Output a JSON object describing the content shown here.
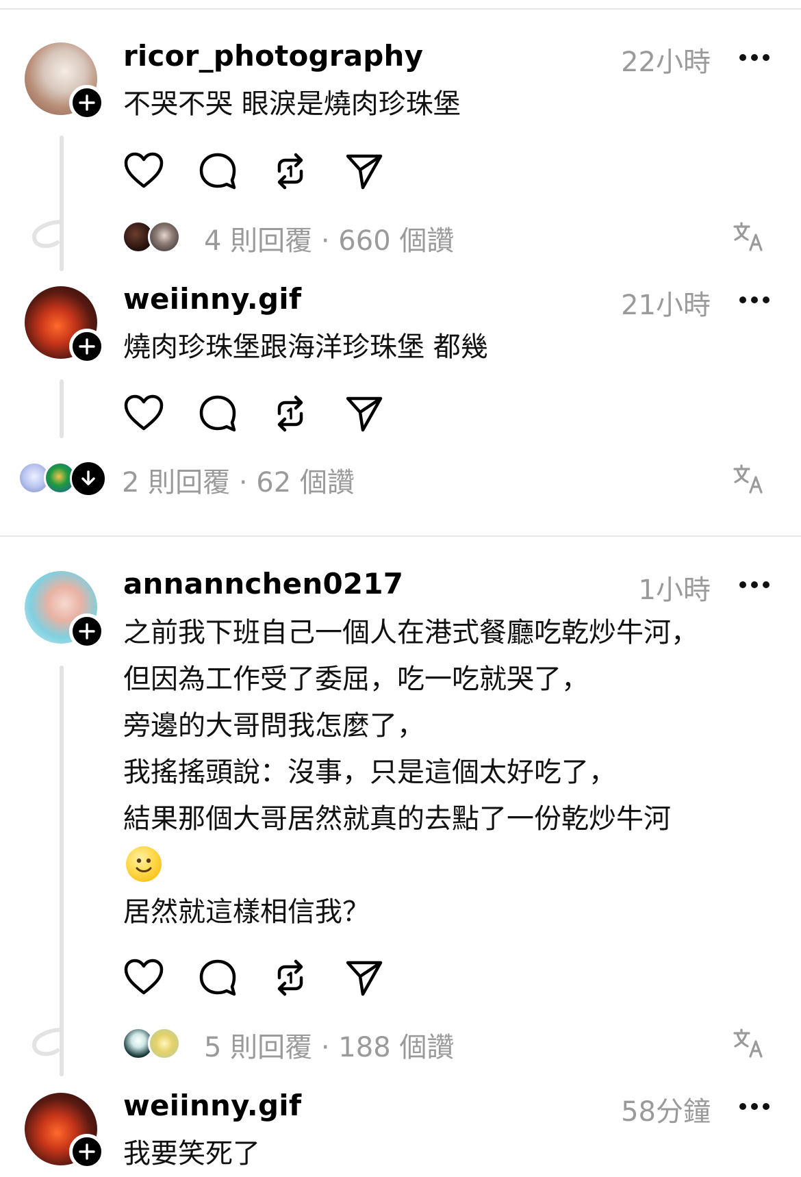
{
  "comments": [
    {
      "username": "ricor_photography",
      "time": "22小時",
      "lines": [
        "不哭不哭 眼淚是燒肉珍珠堡"
      ],
      "stats": "4 則回覆 · 660 個讚"
    },
    {
      "username": "weiinny.gif",
      "time": "21小時",
      "lines": [
        "燒肉珍珠堡跟海洋珍珠堡 都幾"
      ],
      "stats": "2 則回覆 · 62 個讚"
    },
    {
      "username": "annannchen0217",
      "time": "1小時",
      "lines": [
        "之前我下班自己一個人在港式餐廳吃乾炒牛河，",
        "但因為工作受了委屈，吃一吃就哭了，",
        "旁邊的大哥問我怎麼了，",
        "我搖搖頭說：沒事，只是這個太好吃了，",
        "結果那個大哥居然就真的去點了一份乾炒牛河",
        "居然就這樣相信我？"
      ],
      "stats": "5 則回覆 · 188 個讚"
    },
    {
      "username": "weiinny.gif",
      "time": "58分鐘",
      "lines": [
        "我要笑死了"
      ]
    }
  ],
  "icons": {
    "like": "heart-icon",
    "comment": "comment-bubble-icon",
    "repost": "repost-icon",
    "share": "send-icon",
    "more": "more-dots-icon",
    "translate": "translate-icon",
    "follow": "plus-icon",
    "expand": "arrow-down-icon",
    "emoji": "slightly-smiling-face-emoji"
  },
  "colors": {
    "text": "#000000",
    "muted": "#9a9a9a",
    "divider": "#e6e6e6",
    "background": "#ffffff"
  }
}
